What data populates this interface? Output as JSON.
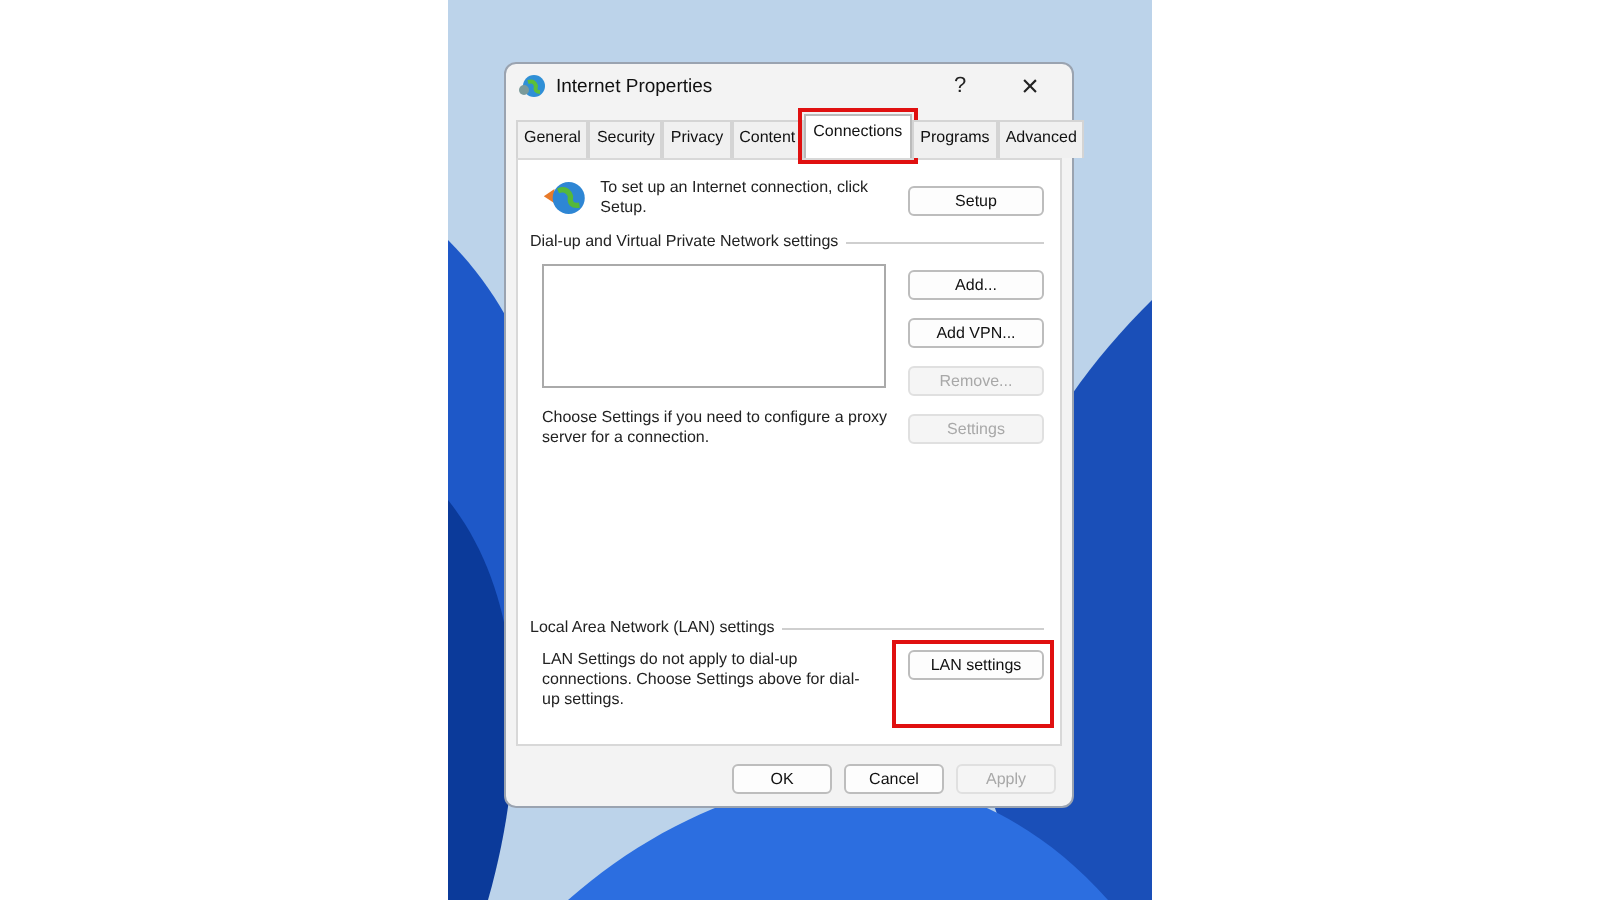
{
  "window": {
    "title": "Internet Properties",
    "help": "?",
    "close": "×"
  },
  "tabs": [
    {
      "label": "General",
      "selected": false,
      "highlighted": false
    },
    {
      "label": "Security",
      "selected": false,
      "highlighted": false
    },
    {
      "label": "Privacy",
      "selected": false,
      "highlighted": false
    },
    {
      "label": "Content",
      "selected": false,
      "highlighted": false
    },
    {
      "label": "Connections",
      "selected": true,
      "highlighted": true
    },
    {
      "label": "Programs",
      "selected": false,
      "highlighted": false
    },
    {
      "label": "Advanced",
      "selected": false,
      "highlighted": false
    }
  ],
  "setup": {
    "text": "To set up an Internet connection, click Setup.",
    "button": {
      "label": "Setup",
      "disabled": false
    }
  },
  "dialup": {
    "heading": "Dial-up and Virtual Private Network settings",
    "buttons": [
      {
        "label": "Add...",
        "disabled": false
      },
      {
        "label": "Add VPN...",
        "disabled": false
      },
      {
        "label": "Remove...",
        "disabled": true
      }
    ],
    "proxy_text": "Choose Settings if you need to configure a proxy server for a connection.",
    "settings_button": {
      "label": "Settings",
      "disabled": true
    }
  },
  "lan": {
    "heading": "Local Area Network (LAN) settings",
    "text": "LAN Settings do not apply to dial-up connections. Choose Settings above for dial-up settings.",
    "button": {
      "label": "LAN settings",
      "disabled": false,
      "highlighted": true
    }
  },
  "footer_buttons": [
    {
      "label": "OK",
      "disabled": false
    },
    {
      "label": "Cancel",
      "disabled": false
    },
    {
      "label": "Apply",
      "disabled": true
    }
  ]
}
